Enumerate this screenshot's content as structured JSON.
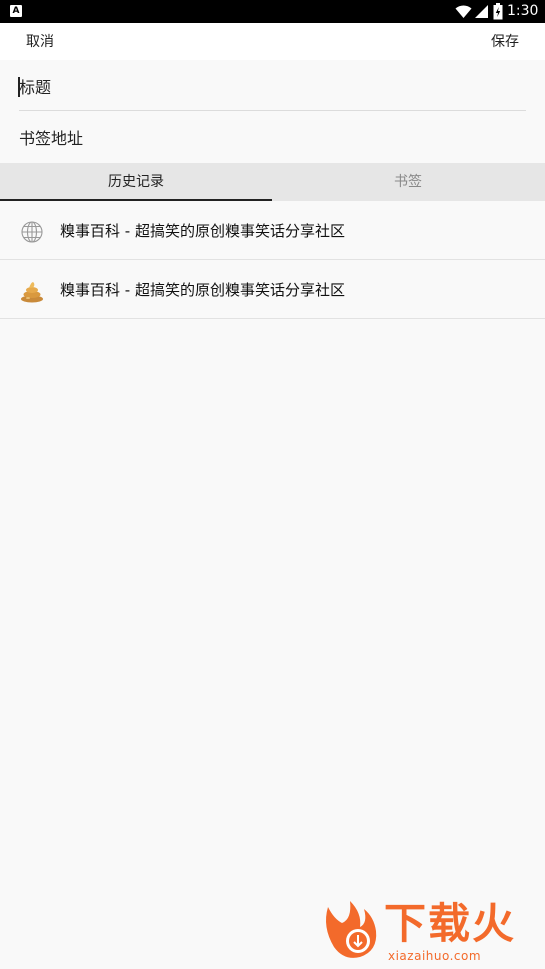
{
  "status_bar": {
    "notification_icon": "A",
    "time": "1:30",
    "icons": [
      "wifi-icon",
      "signal-icon",
      "battery-icon"
    ]
  },
  "toolbar": {
    "cancel_label": "取消",
    "save_label": "保存"
  },
  "form": {
    "title_placeholder": "标题",
    "url_placeholder": "书签地址"
  },
  "tabs": [
    {
      "label": "历史记录",
      "active": true
    },
    {
      "label": "书签",
      "active": false
    }
  ],
  "history": [
    {
      "icon": "globe-icon",
      "title": "糗事百科 - 超搞笑的原创糗事笑话分享社区"
    },
    {
      "icon": "poop-icon",
      "title": "糗事百科 - 超搞笑的原创糗事笑话分享社区"
    }
  ],
  "watermark": {
    "title": "下载火",
    "url": "xiazaihuo.com"
  },
  "colors": {
    "background": "#f9f9f9",
    "tab_bar": "#e6e6e6",
    "watermark": "#f36a2b"
  }
}
